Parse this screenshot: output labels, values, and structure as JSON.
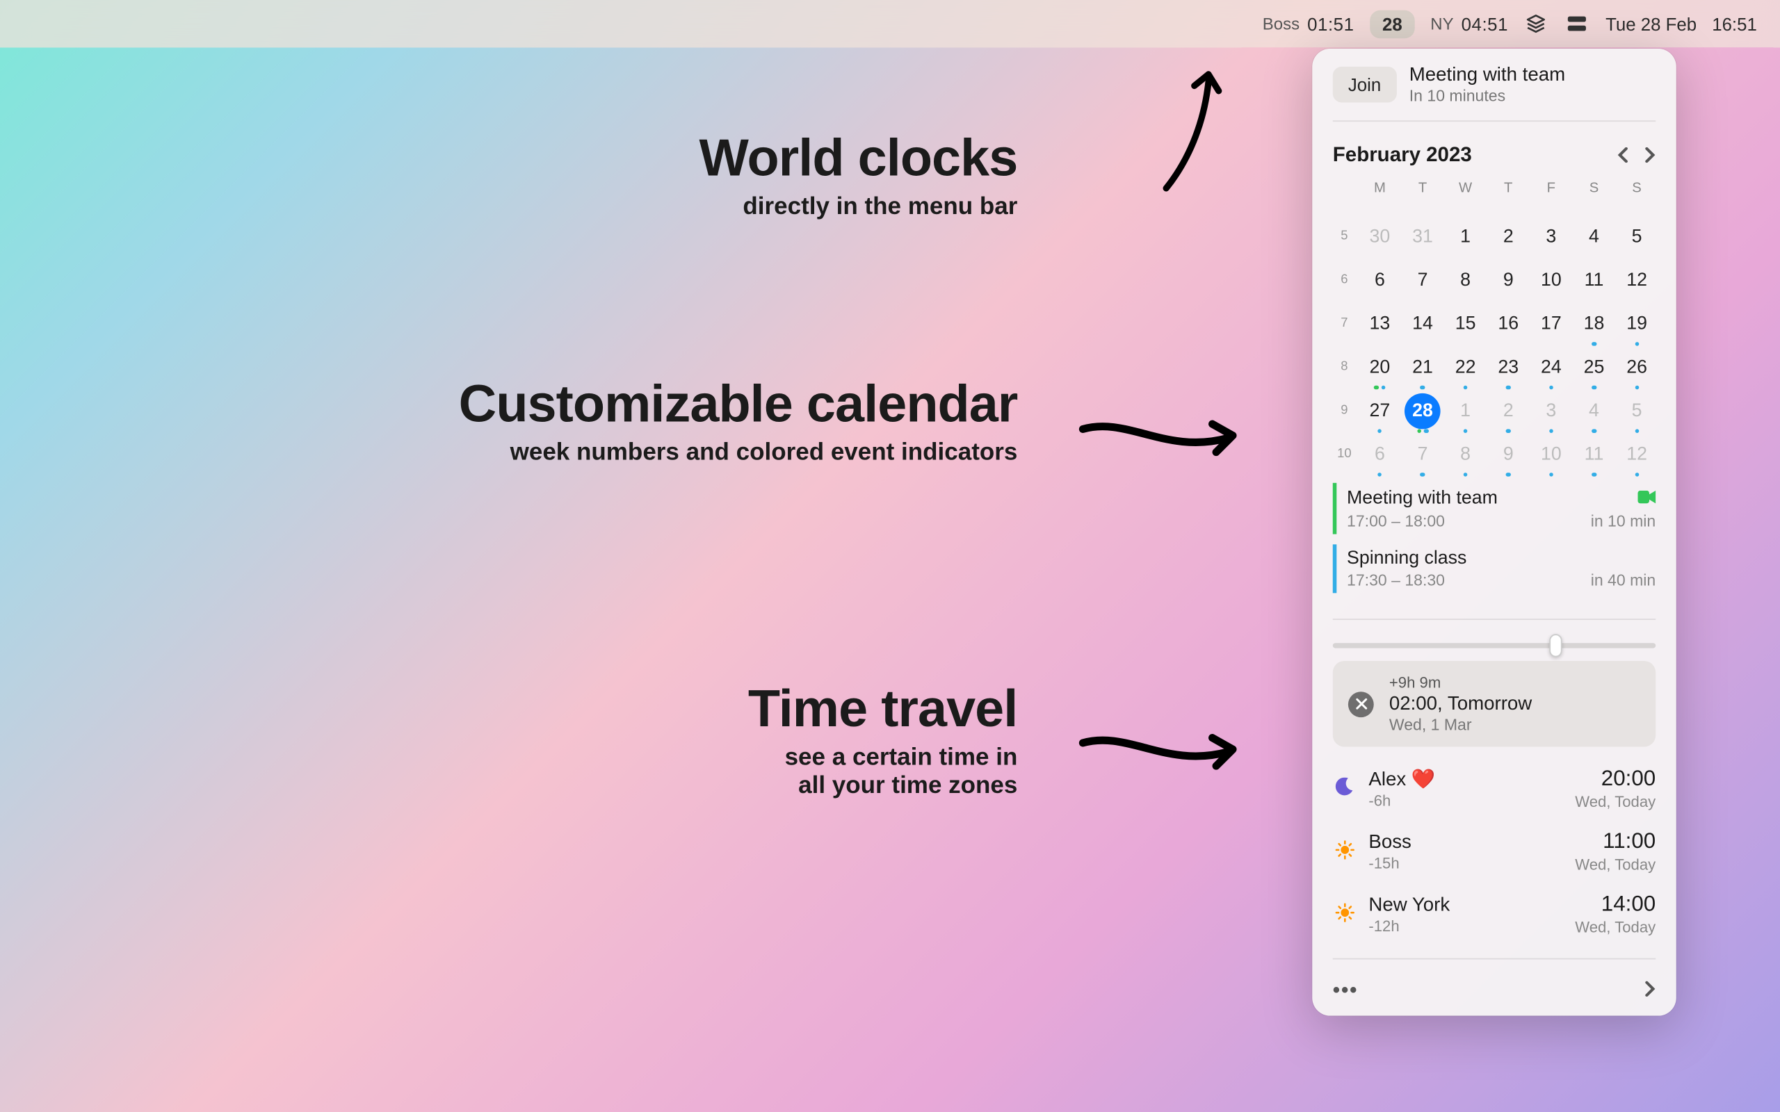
{
  "menubar": {
    "clocks": [
      {
        "label": "Boss",
        "time": "01:51"
      },
      {
        "label": "NY",
        "time": "04:51"
      }
    ],
    "badge": "28",
    "date": "Tue 28 Feb",
    "time": "16:51"
  },
  "annotations": {
    "a1_title": "World clocks",
    "a1_sub": "directly in the menu bar",
    "a2_title": "Customizable calendar",
    "a2_sub": "week numbers and colored event indicators",
    "a3_title": "Time travel",
    "a3_sub_l1": "see a certain time in",
    "a3_sub_l2": "all your time zones"
  },
  "next_event": {
    "join": "Join",
    "title": "Meeting with team",
    "sub": "In 10 minutes"
  },
  "calendar": {
    "title": "February 2023",
    "day_headers": [
      "M",
      "T",
      "W",
      "T",
      "F",
      "S",
      "S"
    ],
    "week_numbers": [
      "5",
      "6",
      "7",
      "8",
      "9",
      "10"
    ],
    "rows": [
      [
        {
          "n": "30",
          "out": true
        },
        {
          "n": "31",
          "out": true
        },
        {
          "n": "1"
        },
        {
          "n": "2"
        },
        {
          "n": "3"
        },
        {
          "n": "4"
        },
        {
          "n": "5"
        }
      ],
      [
        {
          "n": "6"
        },
        {
          "n": "7"
        },
        {
          "n": "8"
        },
        {
          "n": "9"
        },
        {
          "n": "10"
        },
        {
          "n": "11"
        },
        {
          "n": "12"
        }
      ],
      [
        {
          "n": "13"
        },
        {
          "n": "14"
        },
        {
          "n": "15"
        },
        {
          "n": "16"
        },
        {
          "n": "17"
        },
        {
          "n": "18",
          "dots": [
            "b"
          ]
        },
        {
          "n": "19",
          "dots": [
            "b"
          ]
        }
      ],
      [
        {
          "n": "20",
          "dots": [
            "g",
            "b"
          ]
        },
        {
          "n": "21",
          "dots": [
            "b"
          ]
        },
        {
          "n": "22",
          "dots": [
            "b"
          ]
        },
        {
          "n": "23",
          "dots": [
            "b"
          ]
        },
        {
          "n": "24",
          "dots": [
            "b"
          ]
        },
        {
          "n": "25",
          "dots": [
            "b"
          ]
        },
        {
          "n": "26",
          "dots": [
            "b"
          ]
        }
      ],
      [
        {
          "n": "27",
          "dots": [
            "b"
          ]
        },
        {
          "n": "28",
          "today": true,
          "dots": [
            "g",
            "b"
          ]
        },
        {
          "n": "1",
          "out": true,
          "dots": [
            "b"
          ]
        },
        {
          "n": "2",
          "out": true,
          "dots": [
            "b"
          ]
        },
        {
          "n": "3",
          "out": true,
          "dots": [
            "b"
          ]
        },
        {
          "n": "4",
          "out": true,
          "dots": [
            "b"
          ]
        },
        {
          "n": "5",
          "out": true,
          "dots": [
            "b"
          ]
        }
      ],
      [
        {
          "n": "6",
          "out": true,
          "dots": [
            "b"
          ]
        },
        {
          "n": "7",
          "out": true,
          "dots": [
            "b"
          ]
        },
        {
          "n": "8",
          "out": true,
          "dots": [
            "b"
          ]
        },
        {
          "n": "9",
          "out": true,
          "dots": [
            "b"
          ]
        },
        {
          "n": "10",
          "out": true,
          "dots": [
            "b"
          ]
        },
        {
          "n": "11",
          "out": true,
          "dots": [
            "b"
          ]
        },
        {
          "n": "12",
          "out": true,
          "dots": [
            "b"
          ]
        }
      ]
    ]
  },
  "events": [
    {
      "title": "Meeting with team",
      "time": "17:00 – 18:00",
      "rel": "in 10 min",
      "video": true,
      "color": "green"
    },
    {
      "title": "Spinning class",
      "time": "17:30 – 18:30",
      "rel": "in 40 min",
      "video": false,
      "color": "blue"
    }
  ],
  "slider_pos": 0.67,
  "time_travel": {
    "offset": "+9h 9m",
    "line": "02:00, Tomorrow",
    "sub": "Wed, 1 Mar"
  },
  "timezones": [
    {
      "icon": "moon",
      "name": "Alex ❤️",
      "offset": "-6h",
      "time": "20:00",
      "sub": "Wed, Today"
    },
    {
      "icon": "sun",
      "name": "Boss",
      "offset": "-15h",
      "time": "11:00",
      "sub": "Wed, Today"
    },
    {
      "icon": "sun",
      "name": "New York",
      "offset": "-12h",
      "time": "14:00",
      "sub": "Wed, Today"
    }
  ],
  "footer": {
    "more": "•••"
  }
}
